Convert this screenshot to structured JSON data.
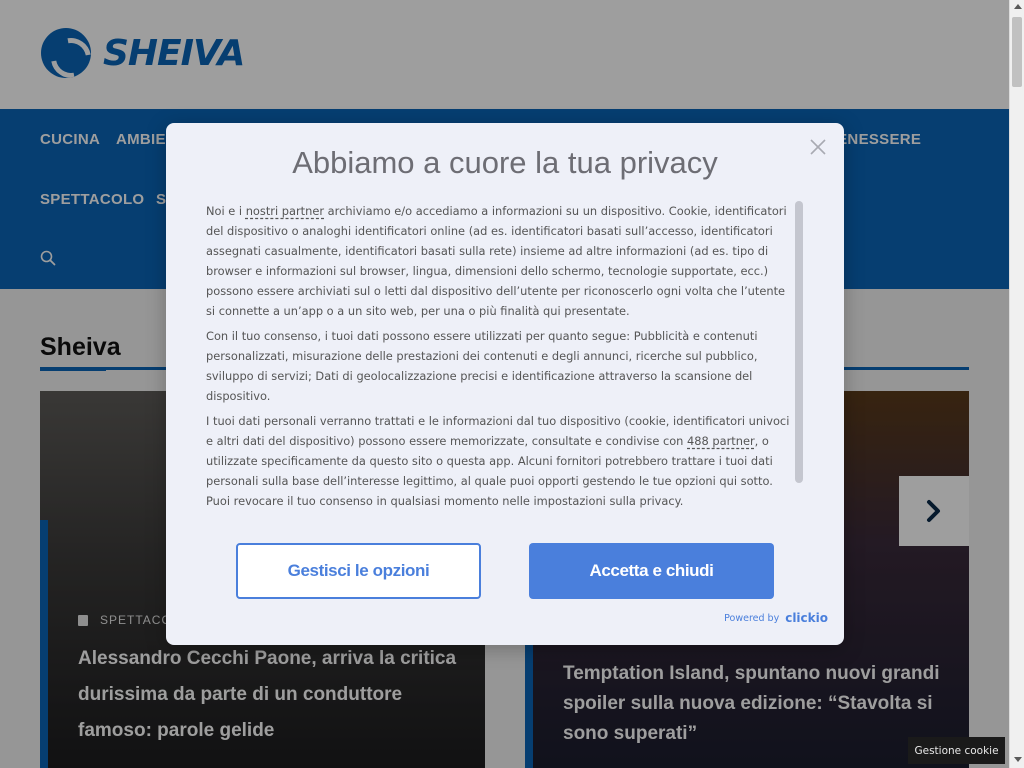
{
  "site": {
    "logo_text": "SHEIVA",
    "brand_color": "#0a64b6"
  },
  "nav": {
    "items": [
      "CUCINA",
      "AMBIENTE",
      "BENESSERE",
      "SPETTACOLO",
      "S"
    ],
    "search_icon": "search-icon"
  },
  "section": {
    "title": "Sheiva"
  },
  "cards": [
    {
      "category": "SPETTACOLO",
      "category_icon": "book-icon",
      "title": "Alessandro Cecchi Paone, arriva la critica durissima da parte di un conduttore famoso: parole gelide"
    },
    {
      "title": "Temptation Island, spuntano nuovi grandi spoiler sulla nuova edizione: “Stavolta si sono superati”"
    }
  ],
  "slider": {
    "next_icon": "chevron-right-icon"
  },
  "consent": {
    "title": "Abbiamo a cuore la tua privacy",
    "p1_a": "Noi e i ",
    "p1_link": "nostri partner",
    "p1_b": " archiviamo e/o accediamo a informazioni su un dispositivo. Cookie, identificatori del dispositivo o analoghi identificatori online (ad es. identificatori basati sull’accesso, identificatori assegnati casualmente, identificatori basati sulla rete) insieme ad altre informazioni (ad es. tipo di browser e informazioni sul browser, lingua, dimensioni dello schermo, tecnologie supportate, ecc.) possono essere archiviati sul o letti dal dispositivo dell’utente per riconoscerlo ogni volta che l’utente si connette a un’app o a un sito web, per una o più finalità qui presentate.",
    "p2": "Con il tuo consenso, i tuoi dati possono essere utilizzati per quanto segue: Pubblicità e contenuti personalizzati, misurazione delle prestazioni dei contenuti e degli annunci, ricerche sul pubblico, sviluppo di servizi; Dati di geolocalizzazione precisi e identificazione attraverso la scansione del dispositivo.",
    "p3_a": "I tuoi dati personali verranno trattati e le informazioni dal tuo dispositivo (cookie, identificatori univoci e altri dati del dispositivo) possono essere memorizzate, consultate e condivise con ",
    "p3_link": "488 partner",
    "p3_b": ", o utilizzate specificamente da questo sito o questa app. Alcuni fornitori potrebbero trattare i tuoi dati personali sulla base dell’interesse legittimo, al quale puoi opporti gestendo le tue opzioni qui sotto. Puoi revocare il tuo consenso in qualsiasi momento nelle impostazioni sulla privacy.",
    "btn_manage": "Gestisci le opzioni",
    "btn_accept": "Accetta e chiudi",
    "powered_label": "Powered by",
    "powered_brand": "clickio",
    "accent_color": "#4a7fdc",
    "close_icon": "close-icon"
  },
  "cookie_chip": {
    "label": "Gestione cookie"
  }
}
